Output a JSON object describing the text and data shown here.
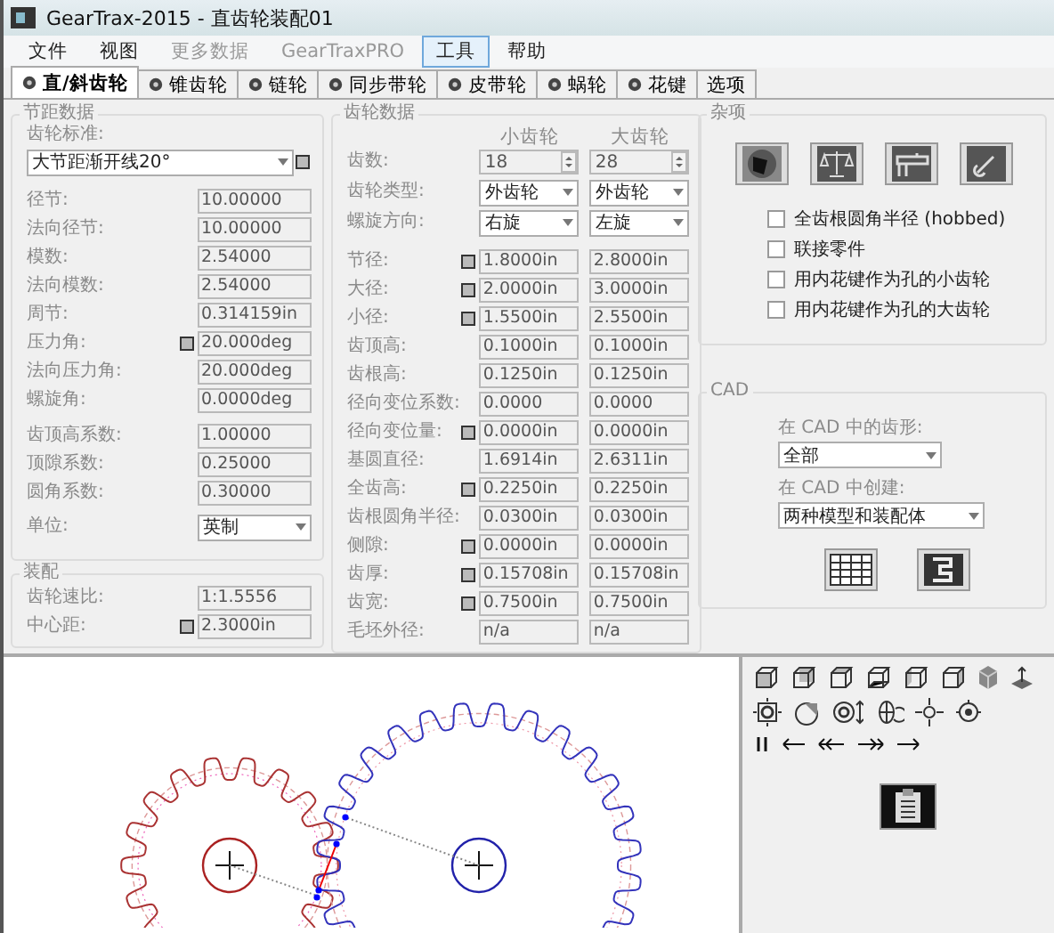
{
  "window": {
    "title": "GearTrax-2015 - 直齿轮装配01"
  },
  "menu": [
    {
      "label": "文件",
      "selected": false,
      "disabled": false
    },
    {
      "label": "视图",
      "selected": false,
      "disabled": false
    },
    {
      "label": "更多数据",
      "selected": false,
      "disabled": true
    },
    {
      "label": "GearTraxPRO",
      "selected": false,
      "disabled": true
    },
    {
      "label": "工具",
      "selected": true,
      "disabled": false
    },
    {
      "label": "帮助",
      "selected": false,
      "disabled": false
    }
  ],
  "tabs": [
    {
      "label": "直/斜齿轮",
      "selected": true,
      "kind": "icon"
    },
    {
      "label": "锥齿轮",
      "selected": false,
      "kind": "icon"
    },
    {
      "label": "链轮",
      "selected": false,
      "kind": "icon"
    },
    {
      "label": "同步带轮",
      "selected": false,
      "kind": "icon"
    },
    {
      "label": "皮带轮",
      "selected": false,
      "kind": "icon"
    },
    {
      "label": "蜗轮",
      "selected": false,
      "kind": "icon"
    },
    {
      "label": "花键",
      "selected": false,
      "kind": "icon"
    },
    {
      "label": "选项",
      "selected": false,
      "kind": "text"
    }
  ],
  "pitch": {
    "title": "节距数据",
    "standard": {
      "label": "齿轮标准:",
      "value": "大节距渐开线20°",
      "lock": true
    },
    "sections": [
      [
        {
          "label": "径节:",
          "value": "10.00000",
          "lock": false
        },
        {
          "label": "法向径节:",
          "value": "10.00000",
          "lock": false
        },
        {
          "label": "模数:",
          "value": "2.54000",
          "lock": false
        },
        {
          "label": "法向模数:",
          "value": "2.54000",
          "lock": false
        },
        {
          "label": "周节:",
          "value": "0.314159in",
          "lock": false
        },
        {
          "label": "压力角:",
          "value": "20.000deg",
          "lock": true
        },
        {
          "label": "法向压力角:",
          "value": "20.000deg",
          "lock": false
        },
        {
          "label": "螺旋角:",
          "value": "0.0000deg",
          "lock": false
        }
      ],
      [
        {
          "label": "齿顶高系数:",
          "value": "1.00000",
          "lock": false
        },
        {
          "label": "顶隙系数:",
          "value": "0.25000",
          "lock": false
        },
        {
          "label": "圆角系数:",
          "value": "0.30000",
          "lock": false
        }
      ]
    ],
    "unit": {
      "label": "单位:",
      "value": "英制"
    }
  },
  "assembly": {
    "title": "装配",
    "rows": [
      {
        "label": "齿轮速比:",
        "value": "1:1.5556",
        "lock": false
      },
      {
        "label": "中心距:",
        "value": "2.3000in",
        "lock": true
      }
    ]
  },
  "gear_data": {
    "title": "齿轮数据",
    "columns": [
      "小齿轮",
      "大齿轮"
    ],
    "sections": [
      [
        {
          "label": "齿数:",
          "kind": "spin",
          "lock": false,
          "values": [
            "18",
            "28"
          ]
        },
        {
          "label": "齿轮类型:",
          "kind": "select",
          "lock": false,
          "values": [
            "外齿轮",
            "外齿轮"
          ]
        },
        {
          "label": "螺旋方向:",
          "kind": "select",
          "lock": false,
          "values": [
            "右旋",
            "左旋"
          ]
        }
      ],
      [
        {
          "label": "节径:",
          "kind": "text",
          "lock": true,
          "values": [
            "1.8000in",
            "2.8000in"
          ]
        },
        {
          "label": "大径:",
          "kind": "text",
          "lock": true,
          "values": [
            "2.0000in",
            "3.0000in"
          ]
        },
        {
          "label": "小径:",
          "kind": "text",
          "lock": true,
          "values": [
            "1.5500in",
            "2.5500in"
          ]
        },
        {
          "label": "齿顶高:",
          "kind": "text",
          "lock": false,
          "values": [
            "0.1000in",
            "0.1000in"
          ]
        },
        {
          "label": "齿根高:",
          "kind": "text",
          "lock": false,
          "values": [
            "0.1250in",
            "0.1250in"
          ]
        },
        {
          "label": "径向变位系数:",
          "kind": "text",
          "lock": false,
          "values": [
            "0.0000",
            "0.0000"
          ]
        },
        {
          "label": "径向变位量:",
          "kind": "text",
          "lock": true,
          "values": [
            "0.0000in",
            "0.0000in"
          ]
        },
        {
          "label": "基圆直径:",
          "kind": "text",
          "lock": false,
          "values": [
            "1.6914in",
            "2.6311in"
          ]
        },
        {
          "label": "全齿高:",
          "kind": "text",
          "lock": true,
          "values": [
            "0.2250in",
            "0.2250in"
          ]
        },
        {
          "label": "齿根圆角半径:",
          "kind": "text",
          "lock": false,
          "values": [
            "0.0300in",
            "0.0300in"
          ]
        },
        {
          "label": "侧隙:",
          "kind": "text",
          "lock": true,
          "values": [
            "0.0000in",
            "0.0000in"
          ]
        },
        {
          "label": "齿厚:",
          "kind": "text",
          "lock": true,
          "values": [
            "0.15708in",
            "0.15708in"
          ]
        },
        {
          "label": "齿宽:",
          "kind": "text",
          "lock": true,
          "values": [
            "0.7500in",
            "0.7500in"
          ]
        },
        {
          "label": "毛坯外径:",
          "kind": "text",
          "lock": false,
          "values": [
            "n/a",
            "n/a"
          ]
        }
      ]
    ]
  },
  "misc": {
    "title": "杂项",
    "options": [
      {
        "label": "全齿根圆角半径 (hobbed)",
        "checked": false
      },
      {
        "label": "联接零件",
        "checked": false
      },
      {
        "label": "用内花键作为孔的小齿轮",
        "checked": false
      },
      {
        "label": "用内花键作为孔的大齿轮",
        "checked": false
      }
    ]
  },
  "cad": {
    "title": "CAD",
    "selects": [
      {
        "label": "在 CAD 中的齿形:",
        "value": "全部"
      },
      {
        "label": "在 CAD 中创建:",
        "value": "两种模型和装配体"
      }
    ]
  }
}
